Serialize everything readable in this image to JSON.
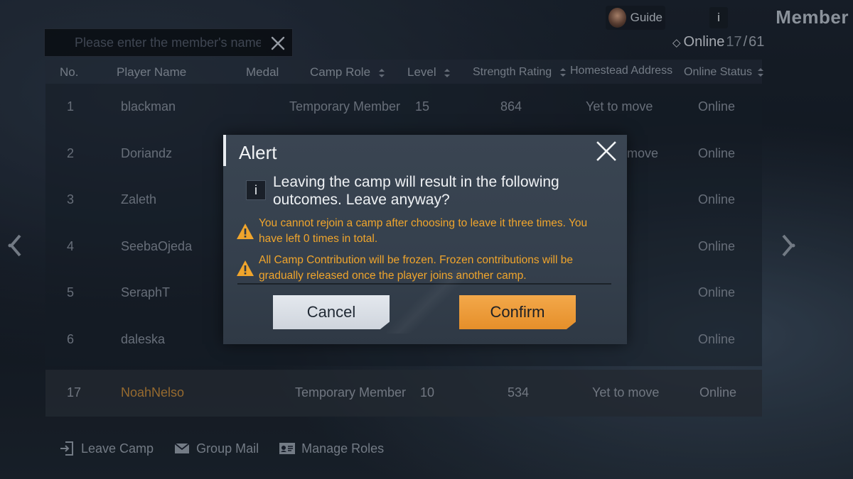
{
  "header": {
    "guide_label": "Guide",
    "info_label": "i",
    "section_title": "Member"
  },
  "search": {
    "placeholder": "Please enter the member's name",
    "value": ""
  },
  "online": {
    "label": "Online",
    "current": "17",
    "separator": "/",
    "total": "61"
  },
  "table": {
    "columns": {
      "no": "No.",
      "name": "Player Name",
      "medal": "Medal",
      "role": "Camp Role",
      "level": "Level",
      "strength": "Strength Rating",
      "address": "Homestead Address",
      "status": "Online Status"
    },
    "rows": [
      {
        "no": "1",
        "name": "blackman",
        "role": "Temporary Member",
        "level": "15",
        "strength": "864",
        "address": "Yet to move",
        "status": "Online"
      },
      {
        "no": "2",
        "name": "Doriandz",
        "role": "",
        "level": "",
        "strength": "",
        "address": "move",
        "status": "Online"
      },
      {
        "no": "3",
        "name": "Zaleth",
        "role": "",
        "level": "",
        "strength": "",
        "address": "",
        "status": "Online"
      },
      {
        "no": "4",
        "name": "SeebaOjeda",
        "role": "",
        "level": "",
        "strength": "",
        "address": "",
        "status": "Online"
      },
      {
        "no": "5",
        "name": "SeraphT",
        "role": "",
        "level": "",
        "strength": "",
        "address": "",
        "status": "Online"
      },
      {
        "no": "6",
        "name": "daleska",
        "role": "",
        "level": "",
        "strength": "",
        "address": "",
        "status": "Online"
      }
    ],
    "self_row": {
      "no": "17",
      "name": "NoahNelso",
      "role": "Temporary Member",
      "level": "10",
      "strength": "534",
      "address": "Yet to move",
      "status": "Online"
    }
  },
  "actions": {
    "leave": "Leave Camp",
    "mail": "Group Mail",
    "roles": "Manage Roles"
  },
  "alert": {
    "title": "Alert",
    "info_glyph": "i",
    "message": "Leaving the camp will result in the following outcomes. Leave anyway?",
    "warnings": [
      "You cannot rejoin a camp after choosing to leave it three times. You have left 0 times in total.",
      "All Camp Contribution will be frozen. Frozen contributions will be gradually released once the player joins another camp."
    ],
    "cancel_label": "Cancel",
    "confirm_label": "Confirm"
  },
  "icons": {
    "close": "close-icon",
    "warning": "warning-icon",
    "sort": "sort-icon",
    "prev": "chevron-left-icon",
    "next": "chevron-right-icon",
    "leave": "exit-icon",
    "mail": "mail-icon",
    "roles": "id-card-icon"
  },
  "colors": {
    "warning_text": "#f0a52c",
    "confirm_button": "#f0a040",
    "cancel_button": "#dde2e8",
    "self_name": "#b8823a"
  }
}
